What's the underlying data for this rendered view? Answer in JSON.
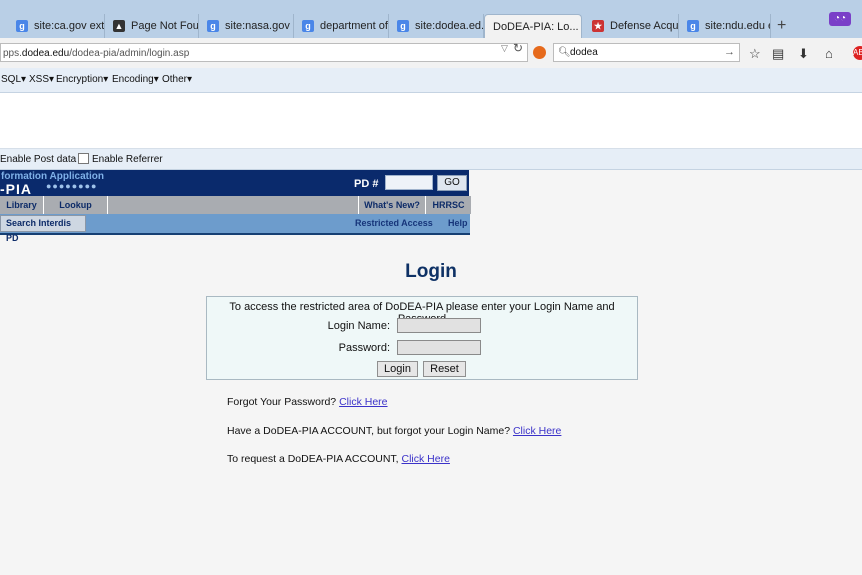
{
  "browser": {
    "tabs": [
      {
        "title": "site:ca.gov ext...",
        "icon": "google-icon"
      },
      {
        "title": "Page Not Fou...",
        "icon": "graduation-cap-icon"
      },
      {
        "title": "site:nasa.gov ...",
        "icon": "google-icon"
      },
      {
        "title": "department of...",
        "icon": "google-icon"
      },
      {
        "title": "site:dodea.ed...",
        "icon": "google-icon"
      },
      {
        "title": "DoDEA-PIA: Lo...",
        "icon": "none",
        "active": true,
        "close": "×"
      },
      {
        "title": "Defense Acqui...",
        "icon": "flag-icon"
      },
      {
        "title": "site:ndu.edu e...",
        "icon": "google-icon"
      }
    ],
    "new_tab": "+",
    "url_prefix": "pps.",
    "url_host": "dodea.edu",
    "url_path": "/dodea-pia/admin/login.asp",
    "search_value": "dodea"
  },
  "devbar": {
    "menus": [
      "SQL▾",
      "XSS▾",
      "Encryption▾",
      "Encoding▾",
      "Other▾"
    ],
    "enable_post": "Enable Post data",
    "enable_referrer": "Enable Referrer"
  },
  "site": {
    "banner_title": "formation Application",
    "banner_logo": "-PIA",
    "banner_dots": "●●●●●●●●",
    "pd_label": "PD #",
    "go": "GO",
    "nav1": [
      "Library",
      "Lookup",
      "What's New?",
      "HRRSC"
    ],
    "search_interdis": "Search Interdis PD",
    "restricted": "Restricted Access",
    "help": "Help"
  },
  "login": {
    "title": "Login",
    "instructions": "To access the restricted area of DoDEA-PIA please enter your Login Name and Password",
    "name_label": "Login Name:",
    "password_label": "Password:",
    "login_btn": "Login",
    "reset_btn": "Reset",
    "forgot_password": "Forgot Your Password?",
    "forgot_login": "Have a DoDEA-PIA ACCOUNT, but forgot your Login Name?",
    "request_account": "To request a DoDEA-PIA ACCOUNT,",
    "click_here": "Click Here"
  }
}
